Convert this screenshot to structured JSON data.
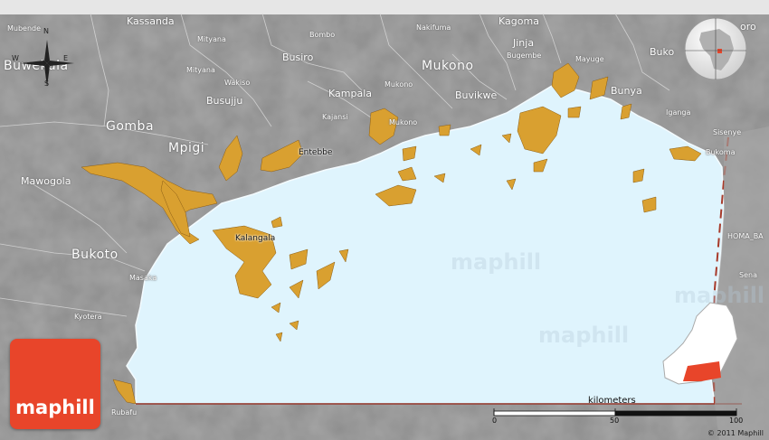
{
  "labels": {
    "kassanda": "Kassanda",
    "mubende": "Mubende",
    "buwekula": "Buwekula",
    "mityana_top": "Mityana",
    "mityana": "Mityana",
    "busiro": "Busiro",
    "bombo": "Bombo",
    "nakifuma": "Nakifuma",
    "kagoma": "Kagoma",
    "jinja": "Jinja",
    "bugembe": "Bugembe",
    "mayuge": "Mayuge",
    "bukooli": "Buko",
    "kooro": "oro",
    "wakiso": "Wakiso",
    "busujju": "Busujju",
    "mukono_region": "Mukono",
    "mukono_town": "Mukono",
    "mukono_small": "Mukono",
    "buvikwe": "Buvikwe",
    "kampala": "Kampala",
    "kajansi": "Kajansi",
    "bunya": "Bunya",
    "iganga": "Iganga",
    "gomba": "Gomba",
    "mpigi": "Mpigi",
    "entebbe": "Entebbe",
    "sisenye": "Sisenye",
    "bukoma": "Bukoma",
    "mawogola": "Mawogola",
    "kalangala": "Kalangala",
    "homa_bay": "HOMA_BA",
    "bukoto": "Bukoto",
    "masaka": "Masaka",
    "sena": "Sena",
    "kyotera": "Kyotera",
    "rubafu": "Rubafu"
  },
  "compass": {
    "n": "N",
    "s": "S",
    "e": "E",
    "w": "W"
  },
  "watermark": "maphill",
  "logo_text": "maphill",
  "scale": {
    "title": "kilometers",
    "ticks": [
      "0",
      "50",
      "100"
    ]
  },
  "copyright": "© 2011 Maphill",
  "colors": {
    "water": "#dff4fd",
    "land": "#8e8e8e",
    "islands": "#d9a030",
    "border": "#a83a2a",
    "logo": "#e8452a"
  },
  "icons": [
    "compass-rose-icon",
    "globe-locator-icon",
    "uganda-inset-icon"
  ]
}
